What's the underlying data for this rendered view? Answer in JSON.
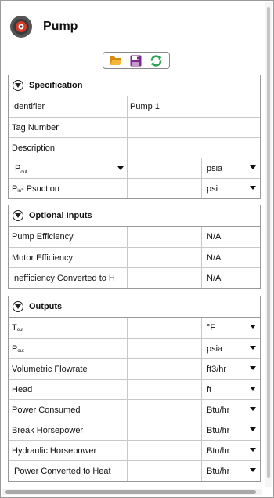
{
  "header": {
    "title": "Pump",
    "logo": "pump-icon"
  },
  "toolbar": {
    "buttons": [
      "folder-open-icon",
      "save-icon",
      "refresh-icon"
    ]
  },
  "colors": {
    "folder": "#f0a020",
    "save": "#7a2a8a",
    "refresh": "#2aa050",
    "border": "#999999"
  },
  "specification": {
    "title": "Specification",
    "identifier_label": "Identifier",
    "identifier_value": "Pump 1",
    "tag_label": "Tag Number",
    "tag_value": "",
    "description_label": "Description",
    "description_value": "",
    "pout_label_main": "P",
    "pout_label_sub": "out",
    "pout_value": "",
    "pout_unit": "psia",
    "pin_label_main": "P",
    "pin_label_sub": "in",
    "pin_label_rest": " - Psuction",
    "pin_value": "",
    "pin_unit": "psi"
  },
  "optional": {
    "title": "Optional Inputs",
    "rows": [
      {
        "label": "Pump Efficiency",
        "value": "",
        "na": "N/A"
      },
      {
        "label": "Motor Efficiency",
        "value": "",
        "na": "N/A"
      },
      {
        "label": "Inefficiency Converted to H",
        "value": "",
        "na": "N/A"
      }
    ]
  },
  "outputs": {
    "title": "Outputs",
    "tout_main": "T",
    "tout_sub": "out",
    "tout_unit": "°F",
    "pout_main": "P",
    "pout_sub": "out",
    "pout_unit": "psia",
    "rows": [
      {
        "label": "Volumetric Flowrate",
        "unit": "ft3/hr"
      },
      {
        "label": "Head",
        "unit": "ft"
      },
      {
        "label": "Power Consumed",
        "unit": "Btu/hr"
      },
      {
        "label": "Break Horsepower",
        "unit": "Btu/hr"
      },
      {
        "label": "Hydraulic Horsepower",
        "unit": "Btu/hr"
      },
      {
        "label": " Power Converted to Heat",
        "unit": "Btu/hr"
      }
    ]
  }
}
